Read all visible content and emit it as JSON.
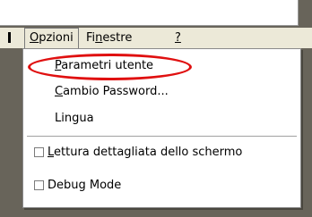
{
  "menubar": {
    "items": [
      {
        "label": "Opzioni",
        "mnemonic": "O",
        "rest": "pzioni",
        "active": true
      },
      {
        "label": "Finestre",
        "pre": "Fi",
        "mnemonic": "n",
        "rest": "estre"
      },
      {
        "label": "?",
        "mnemonic": "?"
      }
    ]
  },
  "dropdown": {
    "items": [
      {
        "pre": "",
        "mnemonic": "P",
        "rest": "arametri utente"
      },
      {
        "pre": "",
        "mnemonic": "C",
        "rest": "ambio Password..."
      },
      {
        "pre": "",
        "mnemonic": "",
        "rest": "Lingua"
      }
    ],
    "check_items": [
      {
        "pre": "",
        "mnemonic": "L",
        "rest": "ettura dettagliata dello schermo",
        "checked": false
      },
      {
        "pre": "",
        "mnemonic": "",
        "rest": "Debug Mode",
        "checked": false
      }
    ]
  },
  "annotation": {
    "color": "#e01010",
    "target": "Parametri utente"
  },
  "colors": {
    "menu_background": "#ece9d8",
    "desktop": "#68645a",
    "dropdown_background": "#ffffff"
  }
}
